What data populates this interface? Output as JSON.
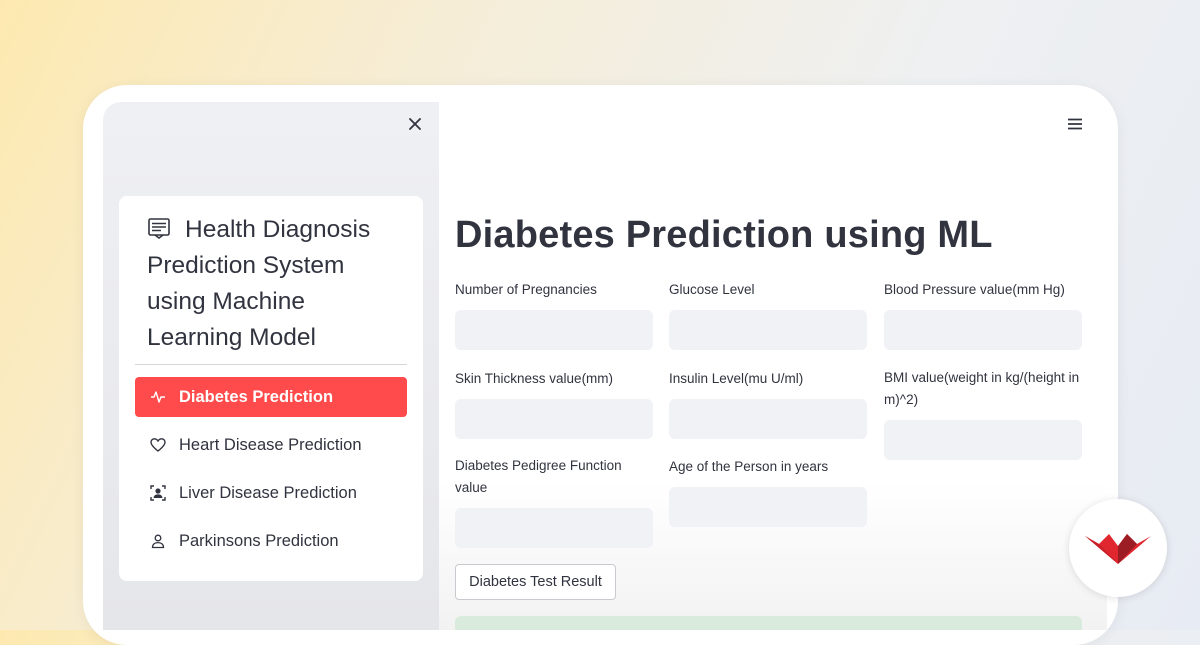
{
  "sidebar": {
    "menu_title": "Health Diagnosis Prediction System using Machine Learning Model",
    "items": [
      {
        "label": "Diabetes Prediction",
        "icon": "activity-icon",
        "active": true
      },
      {
        "label": "Heart Disease Prediction",
        "icon": "heart-icon",
        "active": false
      },
      {
        "label": "Liver Disease Prediction",
        "icon": "person-badge-icon",
        "active": false
      },
      {
        "label": "Parkinsons Prediction",
        "icon": "person-icon",
        "active": false
      }
    ]
  },
  "main": {
    "title": "Diabetes Prediction using ML",
    "fields": [
      {
        "label": "Number of Pregnancies",
        "value": ""
      },
      {
        "label": "Glucose Level",
        "value": ""
      },
      {
        "label": "Blood Pressure value(mm Hg)",
        "value": ""
      },
      {
        "label": "Skin Thickness value(mm)",
        "value": ""
      },
      {
        "label": "Insulin Level(mu U/ml)",
        "value": ""
      },
      {
        "label": "BMI value(weight in kg/(height in m)^2)",
        "value": ""
      },
      {
        "label": "Diabetes Pedigree Function value",
        "value": ""
      },
      {
        "label": "Age of the Person in years",
        "value": ""
      }
    ],
    "button_label": "Diabetes Test Result"
  },
  "colors": {
    "accent": "#ff4b4b",
    "text": "#31333f",
    "input_bg": "#f0f2f6",
    "sidebar_bg": "#eff0f4",
    "success_bg": "#d9ebdd",
    "logo_red": "#e0262e"
  }
}
